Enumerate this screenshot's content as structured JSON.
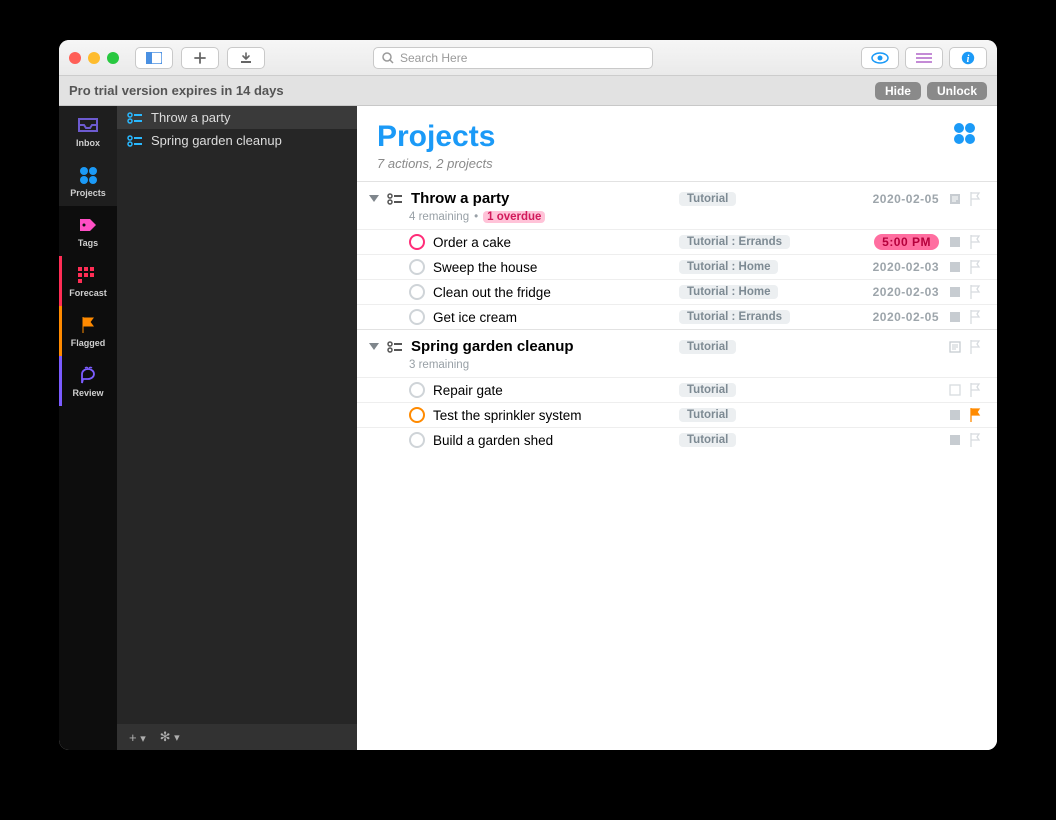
{
  "toolbar": {
    "search_placeholder": "Search Here"
  },
  "trial": {
    "text": "Pro trial version expires in 14 days",
    "hide": "Hide",
    "unlock": "Unlock"
  },
  "nav": [
    {
      "label": "Inbox"
    },
    {
      "label": "Projects"
    },
    {
      "label": "Tags"
    },
    {
      "label": "Forecast"
    },
    {
      "label": "Flagged"
    },
    {
      "label": "Review"
    }
  ],
  "sidebar": {
    "items": [
      "Throw a party",
      "Spring garden cleanup"
    ]
  },
  "header": {
    "title": "Projects",
    "subtitle": "7 actions, 2 projects"
  },
  "projects": [
    {
      "title": "Throw a party",
      "tag": "Tutorial",
      "date": "2020-02-05",
      "remaining": "4 remaining",
      "overdue": "1 overdue",
      "tasks": [
        {
          "title": "Order a cake",
          "tag": "Tutorial : Errands",
          "date": "5:00 PM",
          "overdue": true,
          "circle": "pink"
        },
        {
          "title": "Sweep the house",
          "tag": "Tutorial : Home",
          "date": "2020-02-03"
        },
        {
          "title": "Clean out the fridge",
          "tag": "Tutorial : Home",
          "date": "2020-02-03"
        },
        {
          "title": "Get ice cream",
          "tag": "Tutorial : Errands",
          "date": "2020-02-05"
        }
      ]
    },
    {
      "title": "Spring garden cleanup",
      "tag": "Tutorial",
      "date": "",
      "remaining": "3 remaining",
      "tasks": [
        {
          "title": "Repair gate",
          "tag": "Tutorial",
          "date": ""
        },
        {
          "title": "Test the sprinkler system",
          "tag": "Tutorial",
          "date": "",
          "circle": "orange",
          "flag": true,
          "note": true
        },
        {
          "title": "Build a garden shed",
          "tag": "Tutorial",
          "date": "",
          "note": true
        }
      ]
    }
  ]
}
